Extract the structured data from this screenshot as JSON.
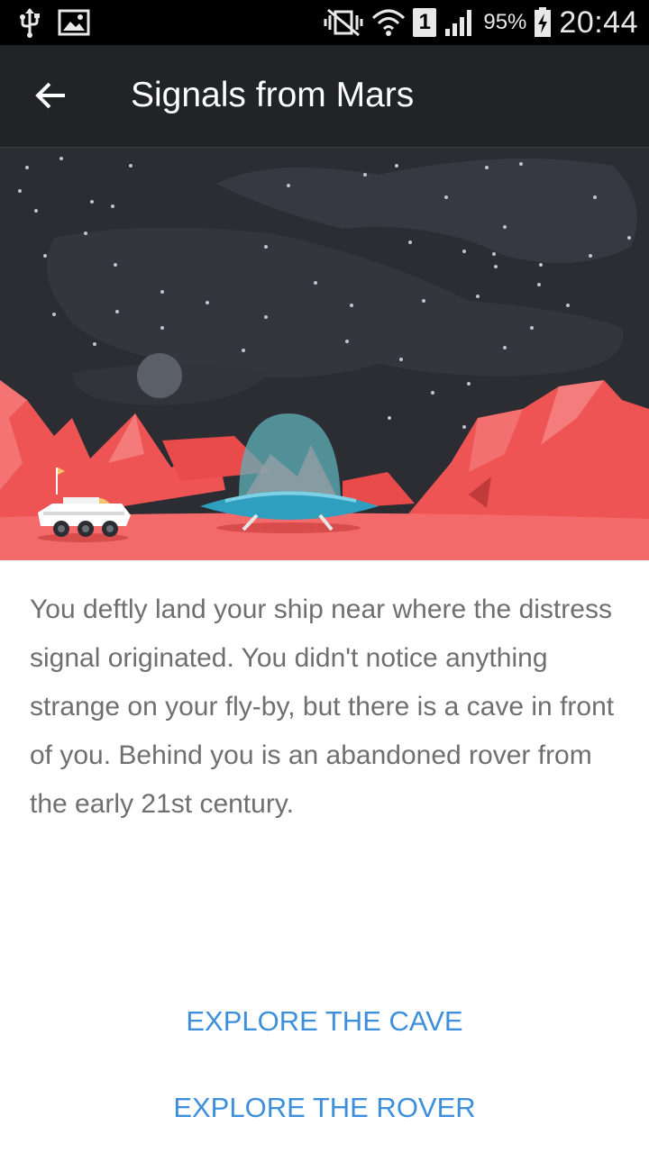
{
  "status_bar": {
    "battery_text": "95%",
    "time": "20:44",
    "sim_slot": "1",
    "icons": [
      "usb-icon",
      "image-icon",
      "vibrate-icon",
      "wifi-icon",
      "sim-icon",
      "signal-icon",
      "battery-charging-icon"
    ]
  },
  "app_bar": {
    "title": "Signals from Mars",
    "back_icon": "arrow-back-icon"
  },
  "scene": {
    "description_icons": [
      "rover",
      "flying-saucer",
      "moon",
      "stars",
      "mars-rocks"
    ],
    "colors": {
      "sky": "#2b2d33",
      "rock": "#ef5b5b",
      "ground": "#f46a6a",
      "saucer": "#2f9fc0"
    }
  },
  "story": {
    "text": "You deftly land your ship near where the distress signal originated. You didn't notice anything strange on your fly-by, but there is a cave in front of you. Behind you is an abandoned rover from the early 21st century."
  },
  "choices": {
    "cave": "EXPLORE THE CAVE",
    "rover": "EXPLORE THE ROVER"
  },
  "colors": {
    "accent": "#3d8fdc",
    "appbar": "#212327",
    "body_text": "#6f6f6f"
  }
}
